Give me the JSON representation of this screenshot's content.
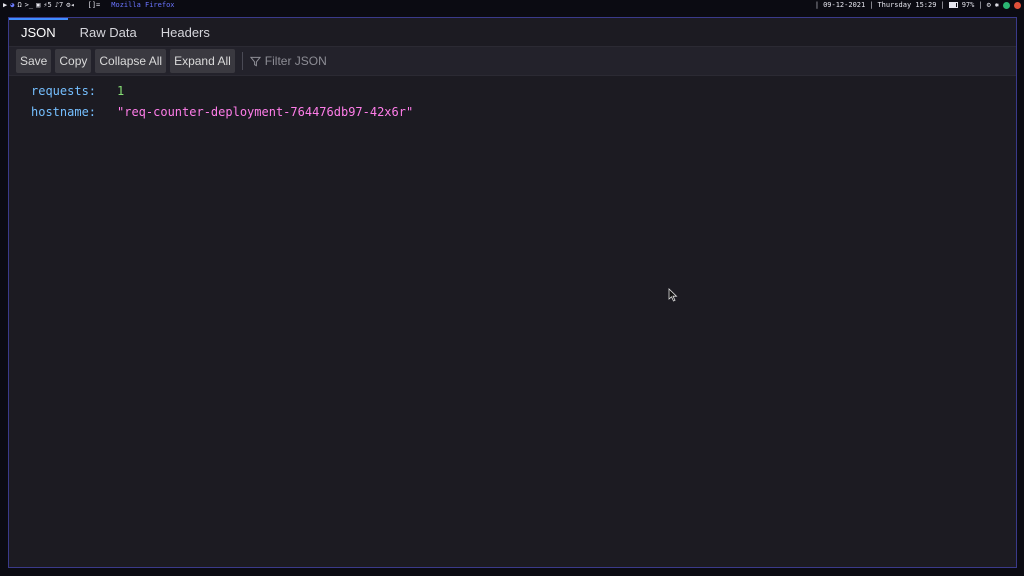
{
  "topbar": {
    "workspaces": [
      "•",
      "Ω•",
      "√•",
      "≡•",
      "5",
      "7"
    ],
    "layout": "[]=",
    "window_title": "Mozilla Firefox",
    "date": "09-12-2021",
    "datetime": "Thursday 15:29",
    "battery": "97%",
    "icons": [
      "play-icon",
      "firefox-icon",
      "terminal-icon",
      "files-icon",
      "mail-icon",
      "settings-icon",
      "bluetooth-icon",
      "volume-icon",
      "network-icon",
      "color-icon",
      "update-icon",
      "browser-icon"
    ]
  },
  "tabs": [
    {
      "label": "JSON",
      "active": true
    },
    {
      "label": "Raw Data",
      "active": false
    },
    {
      "label": "Headers",
      "active": false
    }
  ],
  "toolbar": {
    "save_label": "Save",
    "copy_label": "Copy",
    "collapse_label": "Collapse All",
    "expand_label": "Expand All",
    "filter_placeholder": "Filter JSON"
  },
  "json": [
    {
      "key": "requests:",
      "value": "1",
      "type": "number"
    },
    {
      "key": "hostname:",
      "value": "\"req-counter-deployment-764476db97-42x6r\"",
      "type": "string"
    }
  ],
  "colors": {
    "accent": "#3f8cff",
    "key": "#75bfff",
    "number": "#86de74",
    "string": "#ff7de9",
    "window_border": "#3a3a8a"
  }
}
